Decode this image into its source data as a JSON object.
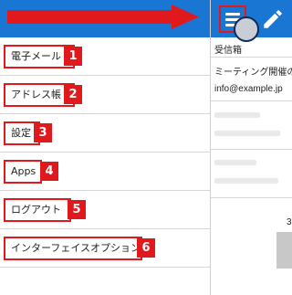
{
  "menu": {
    "items": [
      {
        "label": "電子メール",
        "badge": "1"
      },
      {
        "label": "アドレス帳",
        "badge": "2"
      },
      {
        "label": "設定",
        "badge": "3"
      },
      {
        "label": "Apps",
        "badge": "4"
      },
      {
        "label": "ログアウト",
        "badge": "5"
      },
      {
        "label": "インターフェイスオプション",
        "badge": "6"
      }
    ]
  },
  "inbox": {
    "title": "受信箱",
    "subject": "ミーティング開催の",
    "sender": "info@example.jp",
    "page_number": "3"
  },
  "colors": {
    "header": "#1976d2",
    "accent": "#e0191d"
  },
  "icons": {
    "menu": "hamburger-icon",
    "compose": "pencil-icon",
    "arrow": "right-arrow-icon"
  }
}
